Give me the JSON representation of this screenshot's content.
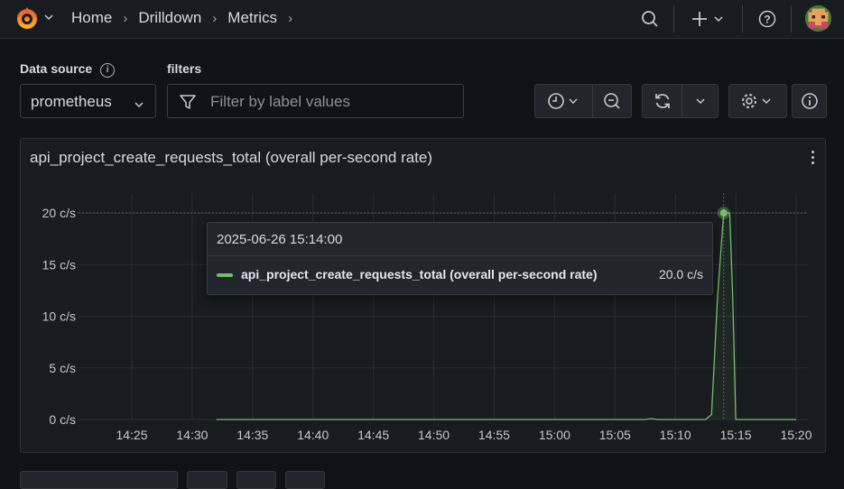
{
  "topbar": {
    "breadcrumbs": [
      "Home",
      "Drilldown",
      "Metrics"
    ],
    "icons": [
      "grafana-logo",
      "search-icon",
      "plus-icon",
      "help-icon",
      "user-avatar"
    ]
  },
  "controls": {
    "data_source_label": "Data source",
    "data_source_value": "prometheus",
    "filters_label": "filters",
    "filter_placeholder": "Filter by label values"
  },
  "panel": {
    "title": "api_project_create_requests_total (overall per-second rate)",
    "y_ticks": [
      "20 c/s",
      "15 c/s",
      "10 c/s",
      "5 c/s",
      "0 c/s"
    ],
    "x_ticks": [
      "14:25",
      "14:30",
      "14:35",
      "14:40",
      "14:45",
      "14:50",
      "14:55",
      "15:00",
      "15:05",
      "15:10",
      "15:15",
      "15:20"
    ]
  },
  "tooltip": {
    "time": "2025-06-26 15:14:00",
    "series_name": "api_project_create_requests_total (overall per-second rate)",
    "value": "20.0 c/s"
  },
  "colors": {
    "series": "#73bf69",
    "background": "#111217",
    "panel": "#181b1f"
  },
  "chart_data": {
    "type": "line",
    "title": "api_project_create_requests_total (overall per-second rate)",
    "xlabel": "",
    "ylabel": "",
    "ylim": [
      0,
      20
    ],
    "y_unit": "c/s",
    "grid": true,
    "series": [
      {
        "name": "api_project_create_requests_total (overall per-second rate)",
        "color": "#73bf69",
        "points": [
          [
            "14:32",
            0
          ],
          [
            "14:40",
            0
          ],
          [
            "14:50",
            0
          ],
          [
            "15:00",
            0
          ],
          [
            "15:05",
            0
          ],
          [
            "15:07:30",
            0
          ],
          [
            "15:08:00",
            0.1
          ],
          [
            "15:08:30",
            0
          ],
          [
            "15:12:30",
            0
          ],
          [
            "15:13:00",
            0.5
          ],
          [
            "15:13:30",
            12
          ],
          [
            "15:14:00",
            20
          ],
          [
            "15:14:30",
            20
          ],
          [
            "15:14:45",
            12
          ],
          [
            "15:15:00",
            0
          ],
          [
            "15:15:30",
            0
          ],
          [
            "15:20",
            0
          ]
        ]
      }
    ]
  }
}
